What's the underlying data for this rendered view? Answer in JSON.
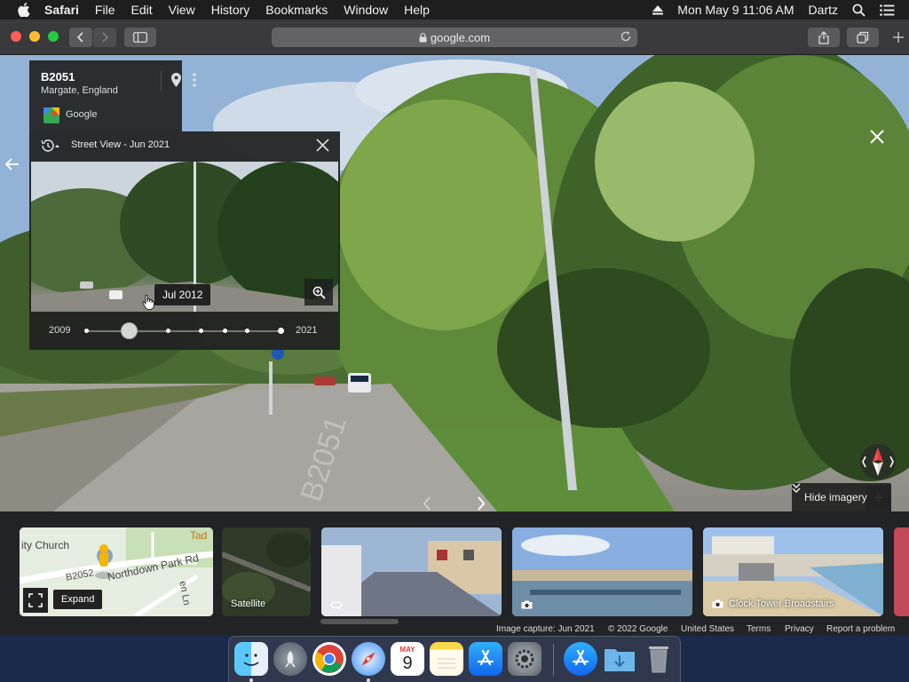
{
  "menubar": {
    "app": "Safari",
    "items": [
      "File",
      "Edit",
      "View",
      "History",
      "Bookmarks",
      "Window",
      "Help"
    ],
    "clock": "Mon May 9  11:06 AM",
    "user": "Dartz"
  },
  "browser": {
    "url": "google.com"
  },
  "place": {
    "road": "B2051",
    "location": "Margate, England",
    "source": "Google"
  },
  "timemachine": {
    "title": "Street View - Jun 2021",
    "tooltip": "Jul 2012",
    "start_year": "2009",
    "end_year": "2021",
    "selected_fraction": 0.2
  },
  "controls": {
    "hide_imagery": "Hide imagery",
    "zoom_in": "+",
    "zoom_out": "−"
  },
  "minimap": {
    "labels": [
      "ity Church",
      "B2052",
      "Northdown Park Rd",
      "Tad",
      "en Ln"
    ],
    "expand": "Expand"
  },
  "filmstrip": {
    "satellite": "Satellite",
    "clock_tower": "Clock Tower Broadstairs"
  },
  "footer": {
    "capture": "Image capture: Jun 2021",
    "copyright": "© 2022 Google",
    "region": "United States",
    "terms": "Terms",
    "privacy": "Privacy",
    "report": "Report a problem"
  },
  "dock": {
    "calendar_month": "MAY",
    "calendar_day": "9",
    "apps": [
      "Finder",
      "Launchpad",
      "Chrome",
      "Safari",
      "Calendar",
      "Notes",
      "App Store",
      "System Preferences",
      "App Store",
      "Downloads",
      "Trash"
    ]
  }
}
